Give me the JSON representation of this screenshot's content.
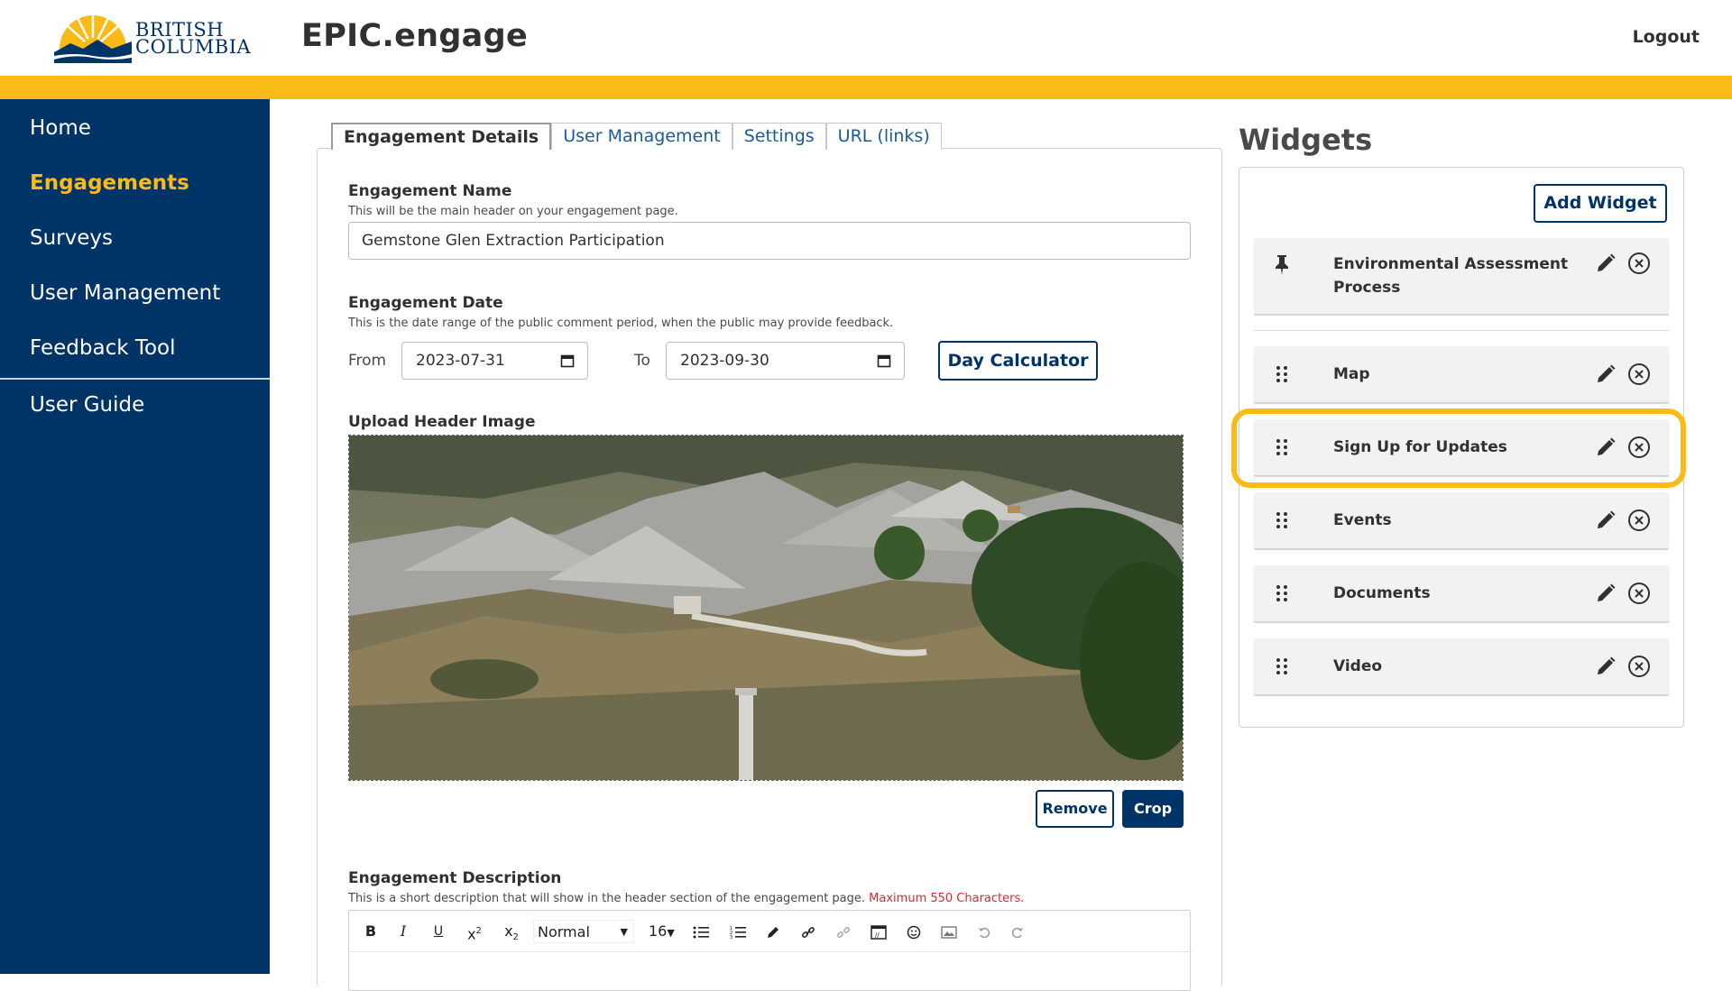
{
  "header": {
    "logo_text_line1": "BRITISH",
    "logo_text_line2": "COLUMBIA",
    "app_title": "EPIC.engage",
    "logout_label": "Logout"
  },
  "sidebar": {
    "items": [
      {
        "label": "Home"
      },
      {
        "label": "Engagements",
        "active": true
      },
      {
        "label": "Surveys"
      },
      {
        "label": "User Management"
      },
      {
        "label": "Feedback Tool"
      },
      {
        "label": "User Guide"
      }
    ]
  },
  "tabs": [
    {
      "label": "Engagement Details",
      "active": true
    },
    {
      "label": "User Management"
    },
    {
      "label": "Settings"
    },
    {
      "label": "URL (links)"
    }
  ],
  "form": {
    "name_label": "Engagement Name",
    "name_help": "This will be the main header on your engagement page.",
    "name_value": "Gemstone Glen Extraction Participation",
    "date_label": "Engagement Date",
    "date_help": "This is the date range of the public comment period, when the public may provide feedback.",
    "from_label": "From",
    "from_value": "2023-07-31",
    "to_label": "To",
    "to_value": "2023-09-30",
    "day_calculator_label": "Day Calculator",
    "image_label": "Upload Header Image",
    "remove_label": "Remove",
    "crop_label": "Crop",
    "description_label": "Engagement Description",
    "description_help": "This is a short description that will show in the header section of the engagement page.",
    "description_warning": "Maximum 550 Characters."
  },
  "editor_toolbar": {
    "block_format": "Normal",
    "font_size": "16",
    "tools": [
      "bold-icon",
      "italic-icon",
      "underline-icon",
      "superscript-icon",
      "subscript-icon",
      "bullet-list-icon",
      "numbered-list-icon",
      "pen-icon",
      "link-icon",
      "unlink-icon",
      "embed-icon",
      "emoji-icon",
      "image-icon",
      "undo-icon",
      "redo-icon"
    ]
  },
  "widgets": {
    "title": "Widgets",
    "add_label": "Add Widget",
    "items": [
      {
        "label_line1": "Environmental Assessment",
        "label_line2": "Process",
        "pinned": true
      },
      {
        "label": "Map"
      },
      {
        "label": "Sign Up for Updates",
        "highlighted": true
      },
      {
        "label": "Events"
      },
      {
        "label": "Documents"
      },
      {
        "label": "Video"
      }
    ]
  },
  "colors": {
    "navy": "#003366",
    "gold": "#fcba19",
    "link_blue": "#1a5a96",
    "warning_red": "#d8292f"
  }
}
